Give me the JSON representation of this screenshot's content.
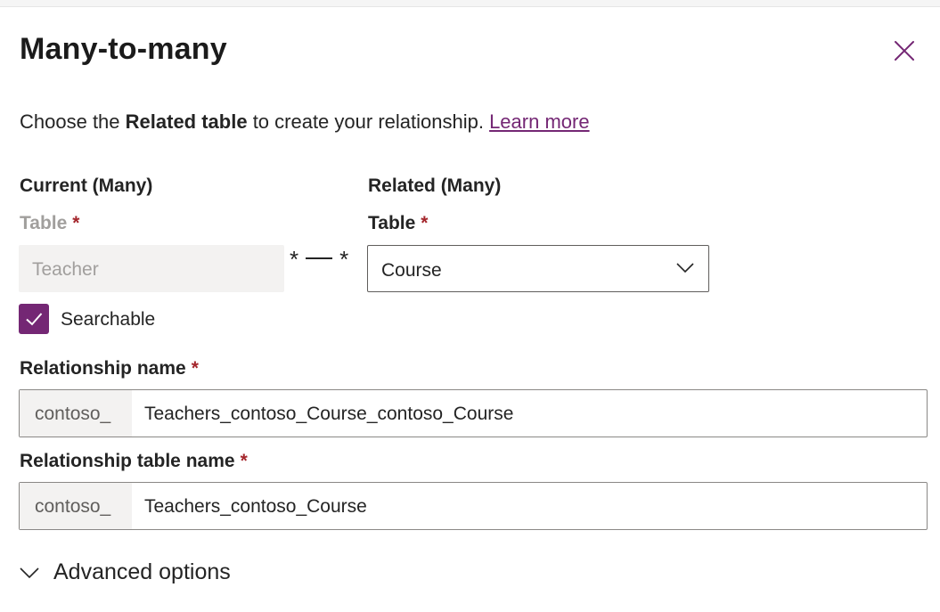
{
  "panel": {
    "title": "Many-to-many",
    "close_label": "Close"
  },
  "description": {
    "prefix": "Choose the ",
    "bold": "Related table",
    "suffix": " to create your relationship. ",
    "link": "Learn more"
  },
  "current": {
    "heading": "Current (Many)",
    "table_label": "Table",
    "required_mark": "*",
    "table_value": "Teacher"
  },
  "connector": {
    "left": "*",
    "right": "*"
  },
  "related": {
    "heading": "Related (Many)",
    "table_label": "Table",
    "required_mark": "*",
    "table_value": "Course"
  },
  "searchable": {
    "label": "Searchable",
    "checked": true
  },
  "relationship_name": {
    "label": "Relationship name",
    "required_mark": "*",
    "prefix": "contoso_",
    "value": "Teachers_contoso_Course_contoso_Course"
  },
  "relationship_table_name": {
    "label": "Relationship table name",
    "required_mark": "*",
    "prefix": "contoso_",
    "value": "Teachers_contoso_Course"
  },
  "advanced": {
    "label": "Advanced options"
  },
  "colors": {
    "accent": "#742774",
    "required": "#a4262c",
    "disabled_bg": "#f3f2f1"
  }
}
